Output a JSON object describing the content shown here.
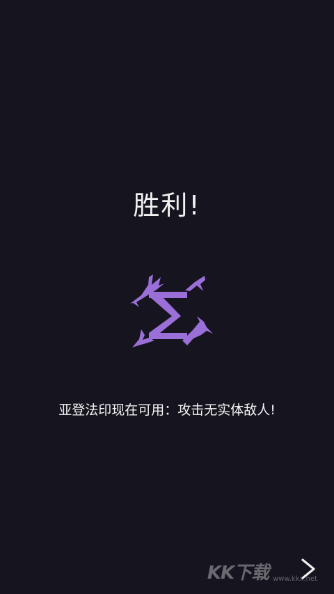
{
  "screen": {
    "title": "胜利!",
    "message": "亚登法印现在可用：攻击无实体敌人!"
  },
  "icons": {
    "sigil": "yrden-sign-icon",
    "next": "chevron-right-icon"
  },
  "watermark": {
    "logo_text": "KK下载",
    "site": "www.kkx.net"
  },
  "colors": {
    "background": "#15141f",
    "sigil": "#9b6fd8",
    "text": "#f2f2f2"
  }
}
